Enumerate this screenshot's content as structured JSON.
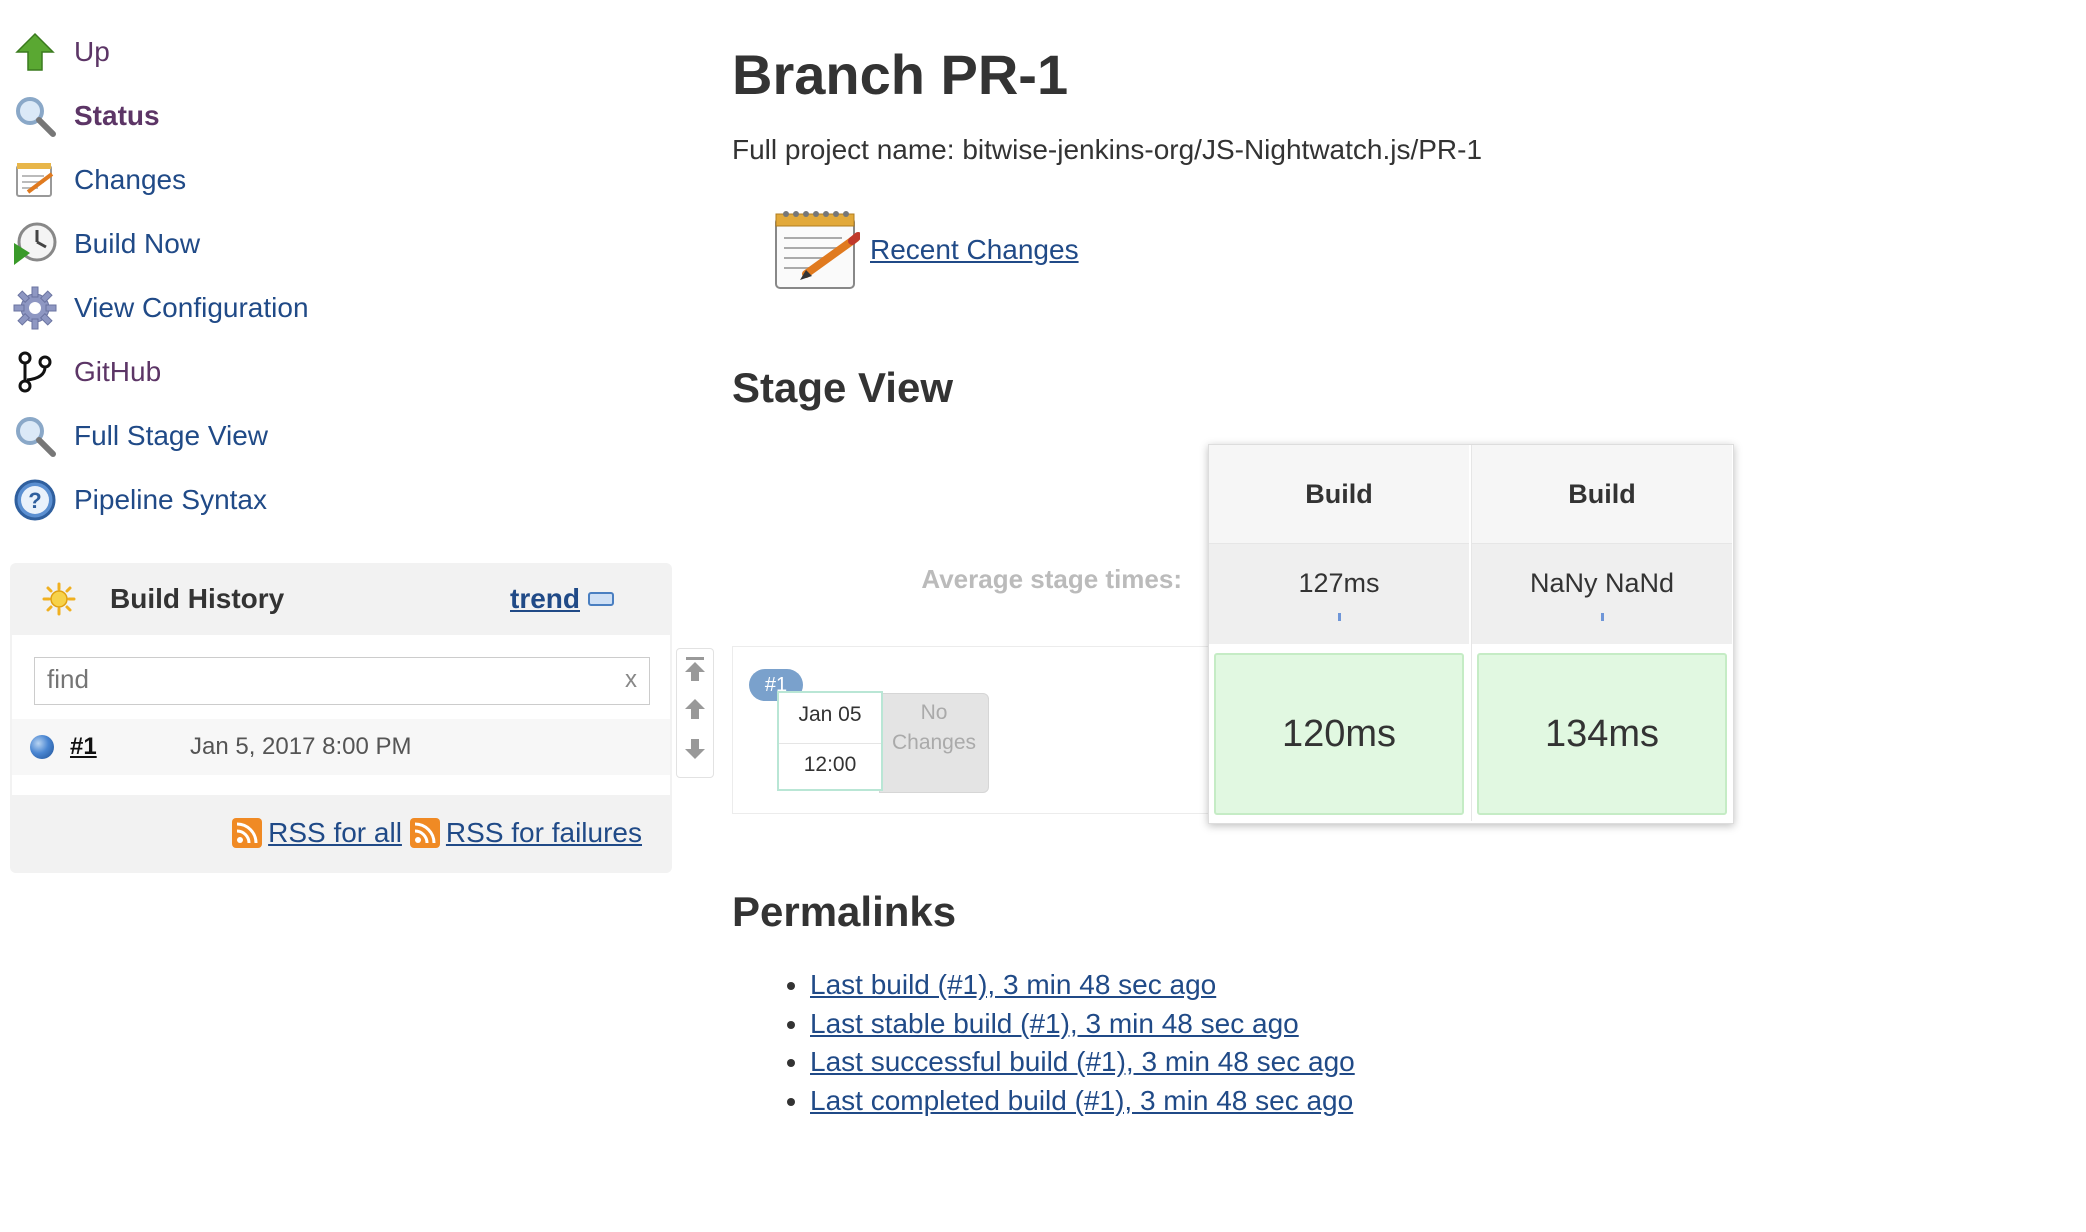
{
  "sidebar": {
    "items": [
      {
        "label": "Up",
        "icon": "up-arrow-icon"
      },
      {
        "label": "Status",
        "icon": "magnifier-icon"
      },
      {
        "label": "Changes",
        "icon": "notepad-icon"
      },
      {
        "label": "Build Now",
        "icon": "clock-play-icon"
      },
      {
        "label": "View Configuration",
        "icon": "gear-icon"
      },
      {
        "label": "GitHub",
        "icon": "branch-icon"
      },
      {
        "label": "Full Stage View",
        "icon": "magnifier-icon"
      },
      {
        "label": "Pipeline Syntax",
        "icon": "help-icon"
      }
    ]
  },
  "build_history": {
    "title": "Build History",
    "trend": "trend",
    "find_placeholder": "find",
    "clear": "x",
    "builds": [
      {
        "number": "#1",
        "date": "Jan 5, 2017 8:00 PM",
        "status_color": "#4a86d2"
      }
    ],
    "rss_all": "RSS for all",
    "rss_failures": "RSS for failures"
  },
  "main": {
    "title": "Branch PR-1",
    "full_name": "Full project name: bitwise-jenkins-org/JS-Nightwatch.js/PR-1",
    "recent_changes": "Recent Changes",
    "stage_view_heading": "Stage View",
    "permalinks_heading": "Permalinks"
  },
  "stage_view": {
    "avg_label": "Average stage times:",
    "stages": [
      {
        "name": "Build",
        "avg": "127ms",
        "run_time": "120ms"
      },
      {
        "name": "Build",
        "avg": "NaNy NaNd",
        "run_time": "134ms"
      }
    ],
    "run": {
      "badge": "#1",
      "date": "Jan 05",
      "time": "12:00",
      "changes_line1": "No",
      "changes_line2": "Changes"
    },
    "success_color": "#e1f8e1"
  },
  "permalinks": [
    "Last build (#1), 3 min 48 sec ago",
    "Last stable build (#1), 3 min 48 sec ago",
    "Last successful build (#1), 3 min 48 sec ago",
    "Last completed build (#1), 3 min 48 sec ago"
  ]
}
